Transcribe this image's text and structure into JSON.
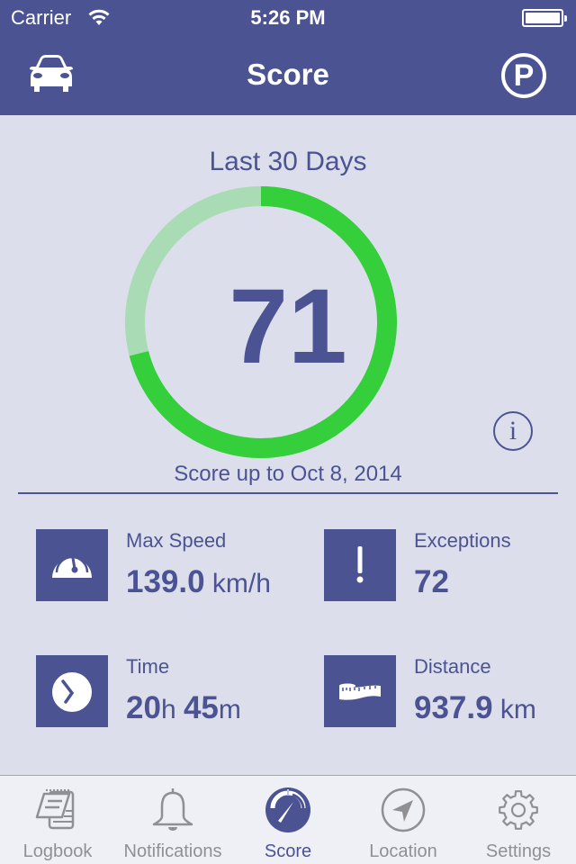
{
  "status_bar": {
    "carrier": "Carrier",
    "time": "5:26 PM",
    "battery_level": 1.0
  },
  "nav": {
    "title": "Score",
    "left_icon": "car-icon",
    "right_icon": "parking-icon",
    "right_label": "P"
  },
  "score": {
    "period": "Last 30 Days",
    "value": "71",
    "fraction": 0.71,
    "date_text": "Score up to Oct 8, 2014",
    "info_label": "i",
    "colors": {
      "fill": "#34cf3a",
      "track": "#a9dbb4",
      "text": "#4b5393"
    }
  },
  "stats": [
    {
      "label": "Max Speed",
      "value_parts": [
        {
          "text": "139.0",
          "bold": true
        },
        {
          "text": " km/h",
          "bold": false
        }
      ],
      "icon": "speedometer-icon"
    },
    {
      "label": "Exceptions",
      "value_parts": [
        {
          "text": "72",
          "bold": true
        }
      ],
      "icon": "exclamation-icon"
    },
    {
      "label": "Time",
      "value_parts": [
        {
          "text": "20",
          "bold": true
        },
        {
          "text": "h ",
          "bold": false
        },
        {
          "text": "45",
          "bold": true
        },
        {
          "text": "m",
          "bold": false
        }
      ],
      "icon": "clock-icon"
    },
    {
      "label": "Distance",
      "value_parts": [
        {
          "text": "937.9",
          "bold": true
        },
        {
          "text": " km",
          "bold": false
        }
      ],
      "icon": "tape-measure-icon"
    }
  ],
  "tabs": [
    {
      "label": "Logbook",
      "icon": "logbook-icon",
      "active": false
    },
    {
      "label": "Notifications",
      "icon": "bell-icon",
      "active": false
    },
    {
      "label": "Score",
      "icon": "gauge-icon",
      "active": true
    },
    {
      "label": "Location",
      "icon": "location-arrow-icon",
      "active": false
    },
    {
      "label": "Settings",
      "icon": "gear-icon",
      "active": false
    }
  ],
  "theme": {
    "primary": "#4b5393",
    "background": "#dcdfeb",
    "tabbar": "#eff0f6",
    "inactive": "#8f8f94"
  }
}
